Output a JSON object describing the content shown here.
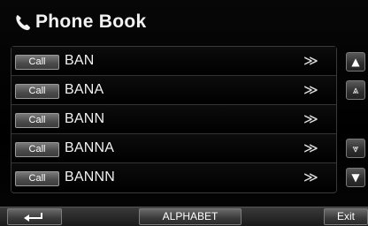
{
  "header": {
    "title": "Phone Book",
    "icon": "phone-icon"
  },
  "contacts": [
    {
      "call_label": "Call",
      "name": "BAN",
      "more": "≫"
    },
    {
      "call_label": "Call",
      "name": "BANA",
      "more": "≫"
    },
    {
      "call_label": "Call",
      "name": "BANN",
      "more": "≫"
    },
    {
      "call_label": "Call",
      "name": "BANNA",
      "more": "≫"
    },
    {
      "call_label": "Call",
      "name": "BANNN",
      "more": "≫"
    }
  ],
  "scroll": {
    "up": "▲",
    "page_up": "⩓",
    "page_down": "⩔",
    "down": "▼"
  },
  "footer": {
    "back_icon": "back-arrow-icon",
    "alphabet_label": "ALPHABET",
    "exit_label": "Exit"
  }
}
